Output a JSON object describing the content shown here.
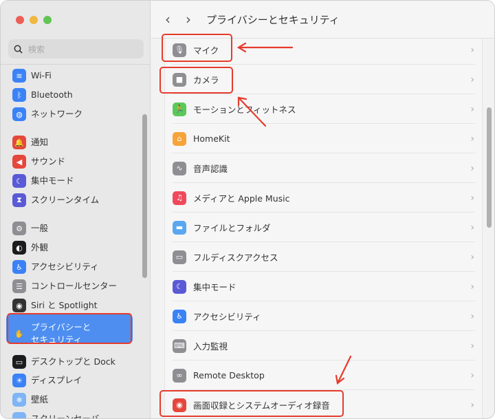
{
  "window": {
    "title": "プライバシーとセキュリティ"
  },
  "search": {
    "placeholder": "検索"
  },
  "sidebar": {
    "items": [
      {
        "label": "Wi-Fi",
        "icon": "wifi-icon",
        "color": "#3b82f6",
        "glyph": "≋"
      },
      {
        "label": "Bluetooth",
        "icon": "bluetooth-icon",
        "color": "#3b82f6",
        "glyph": "ᛒ"
      },
      {
        "label": "ネットワーク",
        "icon": "globe-icon",
        "color": "#3b82f6",
        "glyph": "◍"
      },
      {
        "label": "通知",
        "icon": "bell-icon",
        "color": "#e5473c",
        "glyph": "🔔"
      },
      {
        "label": "サウンド",
        "icon": "speaker-icon",
        "color": "#e5473c",
        "glyph": "◀"
      },
      {
        "label": "集中モード",
        "icon": "moon-icon",
        "color": "#5a5ad6",
        "glyph": "☾"
      },
      {
        "label": "スクリーンタイム",
        "icon": "hourglass-icon",
        "color": "#5a5ad6",
        "glyph": "⧗"
      },
      {
        "label": "一般",
        "icon": "gear-icon",
        "color": "#8e8e93",
        "glyph": "⚙"
      },
      {
        "label": "外観",
        "icon": "appearance-icon",
        "color": "#1c1c1e",
        "glyph": "◐"
      },
      {
        "label": "アクセシビリティ",
        "icon": "accessibility-icon",
        "color": "#3b82f6",
        "glyph": "♿"
      },
      {
        "label": "コントロールセンター",
        "icon": "control-center-icon",
        "color": "#8e8e93",
        "glyph": "☰"
      },
      {
        "label": "Siri と Spotlight",
        "icon": "siri-icon",
        "color": "#333",
        "glyph": "◉"
      },
      {
        "label": "プライバシーと",
        "label2": "セキュリティ",
        "icon": "hand-icon",
        "color": "#4d8ef0",
        "glyph": "✋",
        "selected": true
      },
      {
        "label": "デスクトップと Dock",
        "icon": "dock-icon",
        "color": "#1c1c1e",
        "glyph": "▭"
      },
      {
        "label": "ディスプレイ",
        "icon": "display-icon",
        "color": "#3b82f6",
        "glyph": "☀"
      },
      {
        "label": "壁紙",
        "icon": "wallpaper-icon",
        "color": "#7fb4f5",
        "glyph": "❄"
      },
      {
        "label": "スクリーンセーバ",
        "icon": "screensaver-icon",
        "color": "#7fb4f5",
        "glyph": ""
      }
    ]
  },
  "list": {
    "items": [
      {
        "label": "マイク",
        "icon": "microphone-icon",
        "color": "#8e8e93",
        "glyph": "🎙"
      },
      {
        "label": "カメラ",
        "icon": "camera-icon",
        "color": "#8e8e93",
        "glyph": "■"
      },
      {
        "label": "モーションとフィットネス",
        "icon": "fitness-icon",
        "color": "#5cc85a",
        "glyph": "🏃"
      },
      {
        "label": "HomeKit",
        "icon": "home-icon",
        "color": "#f6a33a",
        "glyph": "⌂"
      },
      {
        "label": "音声認識",
        "icon": "waveform-icon",
        "color": "#8e8e93",
        "glyph": "∿"
      },
      {
        "label": "メディアと Apple Music",
        "icon": "music-icon",
        "color": "#f0495c",
        "glyph": "♫"
      },
      {
        "label": "ファイルとフォルダ",
        "icon": "folder-icon",
        "color": "#5aa7f0",
        "glyph": "▬"
      },
      {
        "label": "フルディスクアクセス",
        "icon": "disk-icon",
        "color": "#8e8e93",
        "glyph": "▭"
      },
      {
        "label": "集中モード",
        "icon": "moon-icon",
        "color": "#5a5ad6",
        "glyph": "☾"
      },
      {
        "label": "アクセシビリティ",
        "icon": "accessibility-icon",
        "color": "#3b82f6",
        "glyph": "♿"
      },
      {
        "label": "入力監視",
        "icon": "keyboard-icon",
        "color": "#8e8e93",
        "glyph": "⌨"
      },
      {
        "label": "Remote Desktop",
        "icon": "binoculars-icon",
        "color": "#8e8e93",
        "glyph": "∞"
      },
      {
        "label": "画面収録とシステムオーディオ録音",
        "icon": "record-icon",
        "color": "#e5473c",
        "glyph": "◉"
      }
    ]
  },
  "colors": {
    "accent": "#4d8ef0",
    "annotation": "#e53b2c"
  }
}
